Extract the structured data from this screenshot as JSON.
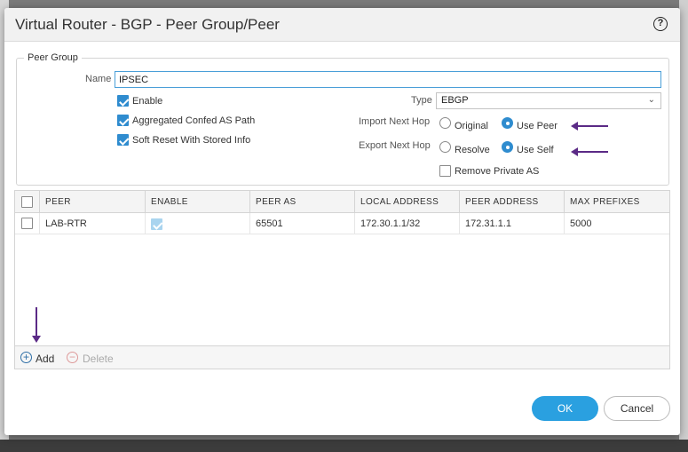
{
  "dialog": {
    "title": "Virtual Router - BGP - Peer Group/Peer",
    "help_icon": "?"
  },
  "peer_group": {
    "legend": "Peer Group",
    "name_label": "Name",
    "name_value": "IPSEC",
    "enable_label": "Enable",
    "enable_checked": true,
    "aggregated_label": "Aggregated Confed AS Path",
    "aggregated_checked": true,
    "soft_reset_label": "Soft Reset With Stored Info",
    "soft_reset_checked": true,
    "type_label": "Type",
    "type_value": "EBGP",
    "import_next_hop_label": "Import Next Hop",
    "import_options": [
      "Original",
      "Use Peer"
    ],
    "import_selected": "Use Peer",
    "export_next_hop_label": "Export Next Hop",
    "export_options": [
      "Resolve",
      "Use Self"
    ],
    "export_selected": "Use Self",
    "remove_private_as_label": "Remove Private AS",
    "remove_private_as_checked": false
  },
  "table": {
    "columns": [
      "PEER",
      "ENABLE",
      "PEER AS",
      "LOCAL ADDRESS",
      "PEER ADDRESS",
      "MAX PREFIXES"
    ],
    "rows": [
      {
        "peer": "LAB-RTR",
        "enable": true,
        "peer_as": "65501",
        "local_address": "172.30.1.1/32",
        "peer_address": "172.31.1.1",
        "max_prefixes": "5000"
      }
    ]
  },
  "footer": {
    "add_label": "Add",
    "delete_label": "Delete",
    "ok_label": "OK",
    "cancel_label": "Cancel"
  },
  "colors": {
    "accent": "#2aa0e0",
    "annotation_arrow": "#5b2a86"
  }
}
